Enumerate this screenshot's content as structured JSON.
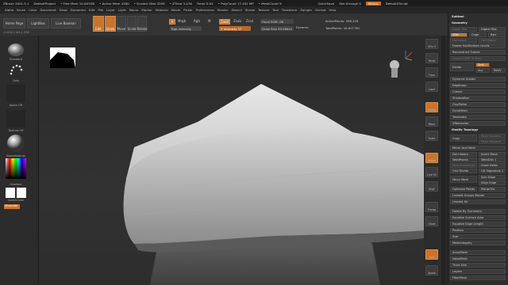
{
  "title_items": [
    "ZBrush 2021.5.1",
    "DefaultProject",
    "• Free Mem 10.007GB",
    "• Active Mem 4380",
    "• Scratch Disk 3209",
    "• ZTime 3.476",
    "Timer 0.02",
    "• PolyCount 17.452 MP",
    "• MeshCount 9",
    "QuickSave",
    "See-through 0",
    "Menus",
    "DefaultZScript"
  ],
  "menu_items": [
    "Alpha",
    "Brush",
    "Color",
    "Document",
    "Draw",
    "Dynamics",
    "Edit",
    "File",
    "Layer",
    "Light",
    "Macro",
    "Marker",
    "Material",
    "Movie",
    "Picker",
    "Preferences",
    "Render",
    "Stencil",
    "Stroke",
    "Texture",
    "Tool",
    "Transform",
    "Zplugin",
    "Zscript",
    "Help"
  ],
  "toolbar": {
    "home": "Home Page",
    "lightbox": "LightBox",
    "live": "Live Boolean",
    "edit": "Edit",
    "draw": "Draw",
    "move": "Move",
    "scale": "Scale",
    "rotate": "Rotate",
    "a": "A",
    "mrgb": "Mrgb",
    "rgb": "Rgb",
    "m": "M",
    "zadd": "Zadd",
    "zsub": "Zsub",
    "zcut": "Zcut",
    "rgb_int": "Rgb Intensity",
    "z_int": "Z Intensity 37",
    "focal": "Focal Shift -98",
    "draw_size": "Draw Size 93.56641",
    "dynamic": "Dynamic",
    "active_pts": "ActivePoints: 398,229",
    "total_pts": "TotalPoints: 18.607 Mil"
  },
  "coords": "-2.418,1.181,1.378",
  "left": {
    "standard": "Standard",
    "dots": "Dots",
    "alpha_off": "Alpha Off",
    "texture_off": "Texture Off",
    "basic_material": "BasicMaterial",
    "gradient": "Gradient",
    "switch_color": "SwitchColor",
    "alternate": "Alternate"
  },
  "right_icons": [
    "SPix 3",
    "Persp",
    "Floor",
    "Local",
    "Frame",
    "Move",
    "Scale",
    "Rotate",
    "Line Fill",
    "PolyF",
    "Transp",
    "Ghost",
    "Solo",
    "Xpose"
  ],
  "subtool": {
    "header": "Subtool",
    "geometry": "Geometry",
    "lower_res": "Lower Res",
    "higher_res": "Higher Res",
    "sdiv": "SDiv",
    "cage": "Cage",
    "rstr": "Rstr",
    "del_lower": "Del Lower",
    "del_higher": "Del Higher",
    "freeze": "Freeze SubDivision Levels",
    "reconstruct": "Reconstruct Subdiv",
    "convert": "Convert BPR To Geo",
    "divide": "Divide",
    "smt": "Smt",
    "suv": "Suv",
    "reuv": "ReUV",
    "items": [
      "Dynamic Subdiv",
      "EdgeLoop",
      "Crease",
      "ShadowBox",
      "ClayPolish",
      "DynaMesh",
      "Tessimate",
      "ZRemesher",
      "Modify Topology"
    ],
    "copy": "Copy",
    "paste_append": "Paste Append",
    "paste_replace": "Paste Replace",
    "mirror_weld": "Mirror And Weld",
    "del_hidden": "Del Hidden",
    "insert_mesh": "Insert Mesh",
    "weld_points": "WeldPoints",
    "weld_dist": "WeldDist 1",
    "mesh_from_brush": "MeshFromBrush",
    "close_holes": "Close Holes",
    "grid_divide": "Grid Divide",
    "gd_segments": "GD Segments 1",
    "micro_mesh": "Micro Mesh",
    "spin_edge": "Spin Edge",
    "align_edge": "Align Edge",
    "optimize": "Optimize Points",
    "merge_tris": "MergeTris",
    "unweld_groups": "Unweld Groups Border",
    "unweld_all": "Unweld All",
    "delete_by_sym": "Delete By Symmetry",
    "eq_surface": "Equalize Surface Area",
    "eq_edge": "Equalize Edge Length",
    "position": "Position",
    "size": "Size",
    "meshintegrity": "MeshIntegrity",
    "arraymesh": "ArrayMesh",
    "nanomesh": "NanoMesh",
    "thick_skin": "Thick Skin",
    "layers": "Layers",
    "fibermesh": "FiberMesh"
  }
}
